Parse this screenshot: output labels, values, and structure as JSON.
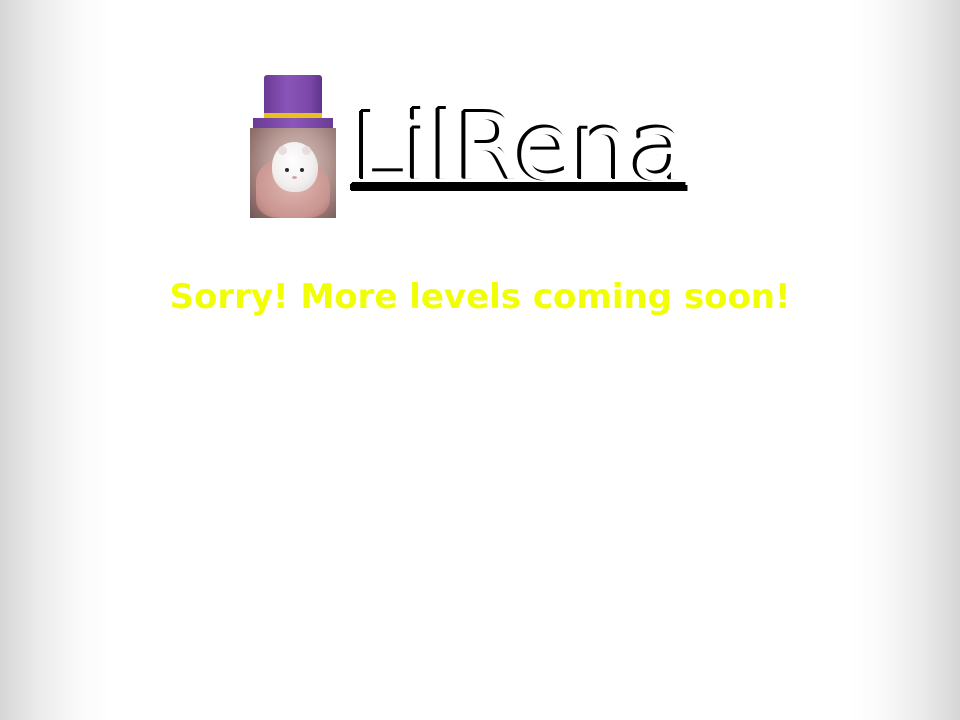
{
  "game": {
    "title": "LilRena",
    "message": "Sorry! More levels coming soon!"
  },
  "icons": {
    "avatar": "hamster-top-hat-icon"
  },
  "colors": {
    "title_fill": "#ffffff",
    "title_outline": "#000000",
    "message": "#f2ff00",
    "hat": "#7a47a8",
    "hat_band": "#e6c21a"
  }
}
